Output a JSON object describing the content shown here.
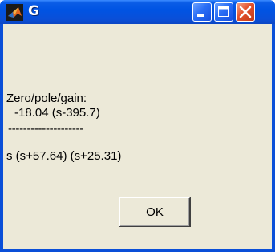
{
  "window": {
    "title": "G",
    "icon": "matlab-icon",
    "controls": [
      "minimize-icon",
      "maximize-icon",
      "close-icon"
    ]
  },
  "message": {
    "header": "Zero/pole/gain:",
    "numerator": "-18.04 (s-395.7)",
    "divider": "--------------------",
    "denominator": "s (s+57.64) (s+25.31)"
  },
  "buttons": {
    "ok_label": "OK"
  },
  "colors": {
    "titlebar": "#0054e3",
    "client_background": "#ece9d8",
    "close_button": "#e2512c"
  }
}
